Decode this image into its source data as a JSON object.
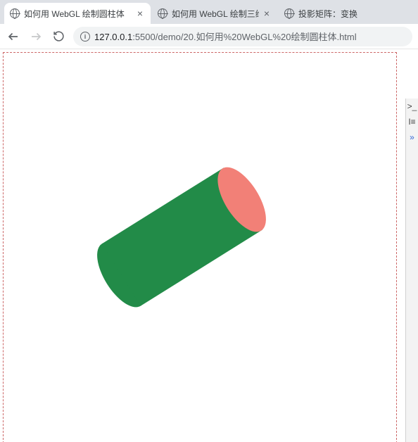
{
  "tabs": [
    {
      "title": "如何用 WebGL 绘制圆柱体"
    },
    {
      "title": "如何用 WebGL 绘制三维立方体"
    },
    {
      "title": "投影矩阵：变换"
    }
  ],
  "closeGlyph": "×",
  "url": {
    "host": "127.0.0.1",
    "port": ":5500",
    "path": "/demo/20.如何用%20WebGL%20绘制圆柱体.html"
  },
  "infoGlyph": "i",
  "devtools": {
    "styles": ">_",
    "console": "I≡",
    "expand": "»"
  },
  "cylinder": {
    "bodyColor": "#228B48",
    "capColor": "#F28077"
  }
}
